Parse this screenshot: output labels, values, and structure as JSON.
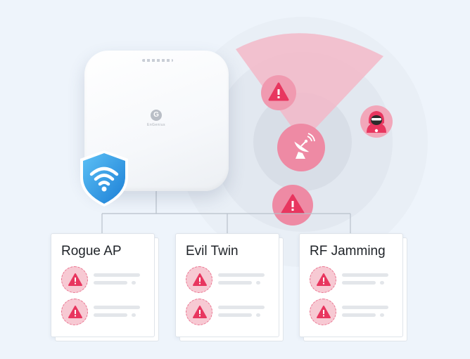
{
  "device": {
    "logo_glyph": "G",
    "brand_text": "EnGenius"
  },
  "categories": [
    {
      "label": "Rogue AP"
    },
    {
      "label": "Evil Twin"
    },
    {
      "label": "RF Jamming"
    }
  ],
  "icons": {
    "shield": "shield-wifi-icon",
    "satellite": "satellite-dish-icon",
    "hacker": "hacker-icon",
    "warning": "warning-triangle-icon"
  },
  "colors": {
    "background": "#eef4fb",
    "alert_pink": "#ea3b67",
    "alert_light": "#f7c9d3",
    "shield_blue": "#2f9be8",
    "radar_beam": "#f3b9c8"
  }
}
